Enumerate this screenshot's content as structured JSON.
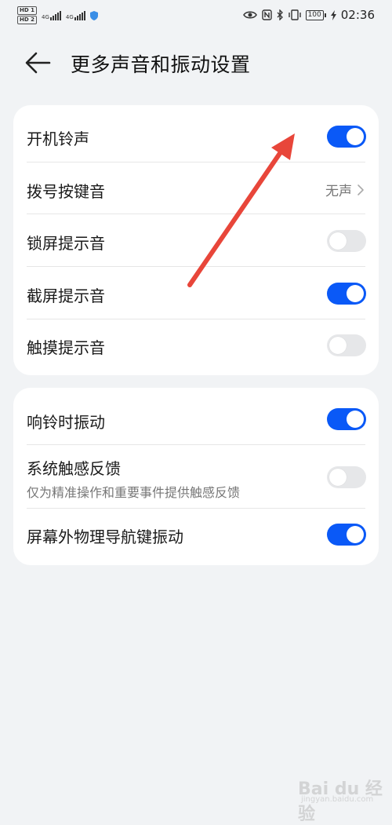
{
  "status_bar": {
    "hd1": "HD 1",
    "hd2": "HD 2",
    "net1": "4G",
    "net2": "4G",
    "battery": "100",
    "time": "02:36",
    "icons": [
      "eye-icon",
      "nfc-icon",
      "bluetooth-icon",
      "vibrate-icon",
      "battery-icon",
      "charging-icon"
    ]
  },
  "header": {
    "title": "更多声音和振动设置"
  },
  "sound_section": {
    "rows": [
      {
        "label": "开机铃声",
        "toggle": "on"
      },
      {
        "label": "拨号按键音",
        "value": "无声"
      },
      {
        "label": "锁屏提示音",
        "toggle": "off"
      },
      {
        "label": "截屏提示音",
        "toggle": "on"
      },
      {
        "label": "触摸提示音",
        "toggle": "off"
      }
    ]
  },
  "vibration_section": {
    "rows": [
      {
        "label": "响铃时振动",
        "toggle": "on"
      },
      {
        "label": "系统触感反馈",
        "sub": "仅为精准操作和重要事件提供触感反馈",
        "toggle": "off"
      },
      {
        "label": "屏幕外物理导航键振动",
        "toggle": "on"
      }
    ]
  },
  "colors": {
    "accent": "#0a59f7",
    "annotation": "#e8463a",
    "background": "#f1f3f5"
  },
  "watermark": {
    "main": "Bai du 经验",
    "sub": "jingyan.baidu.com"
  }
}
